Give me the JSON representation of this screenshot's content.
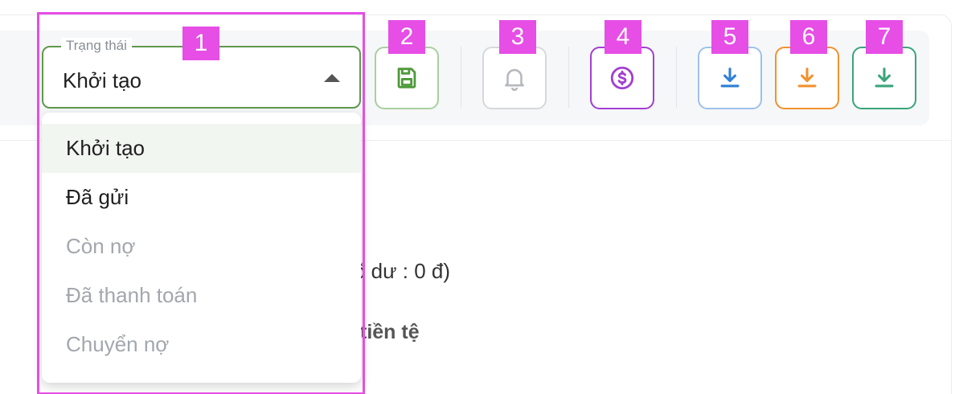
{
  "status_select": {
    "legend": "Trạng thái",
    "value": "Khởi tạo",
    "options": [
      {
        "label": "Khởi tạo",
        "state": "selected"
      },
      {
        "label": "Đã gửi",
        "state": "enabled"
      },
      {
        "label": "Còn nợ",
        "state": "disabled"
      },
      {
        "label": "Đã thanh toán",
        "state": "disabled"
      },
      {
        "label": "Chuyển nợ",
        "state": "disabled"
      }
    ]
  },
  "actions": [
    {
      "id": "save",
      "icon": "floppy-disk-icon",
      "color": "#4e9a3a",
      "border": "#a9cfa0"
    },
    {
      "id": "notify",
      "icon": "bell-icon",
      "color": "#b5b8bd",
      "border": "#d6d8db"
    },
    {
      "id": "payment",
      "icon": "dollar-circle-icon",
      "color": "#a23fd1",
      "border": "#a23fd1"
    },
    {
      "id": "download-blue",
      "icon": "download-icon",
      "color": "#2f7fd6",
      "border": "#9ec2e8"
    },
    {
      "id": "download-orange",
      "icon": "download-icon",
      "color": "#f0922e",
      "border": "#f0922e"
    },
    {
      "id": "download-green",
      "icon": "download-icon",
      "color": "#3aa57a",
      "border": "#3aa57a"
    }
  ],
  "background_text": {
    "balance_fragment": "ố dư : 0 đ)",
    "currency_fragment": "tiền tệ"
  },
  "annotations": [
    "1",
    "2",
    "3",
    "4",
    "5",
    "6",
    "7"
  ]
}
